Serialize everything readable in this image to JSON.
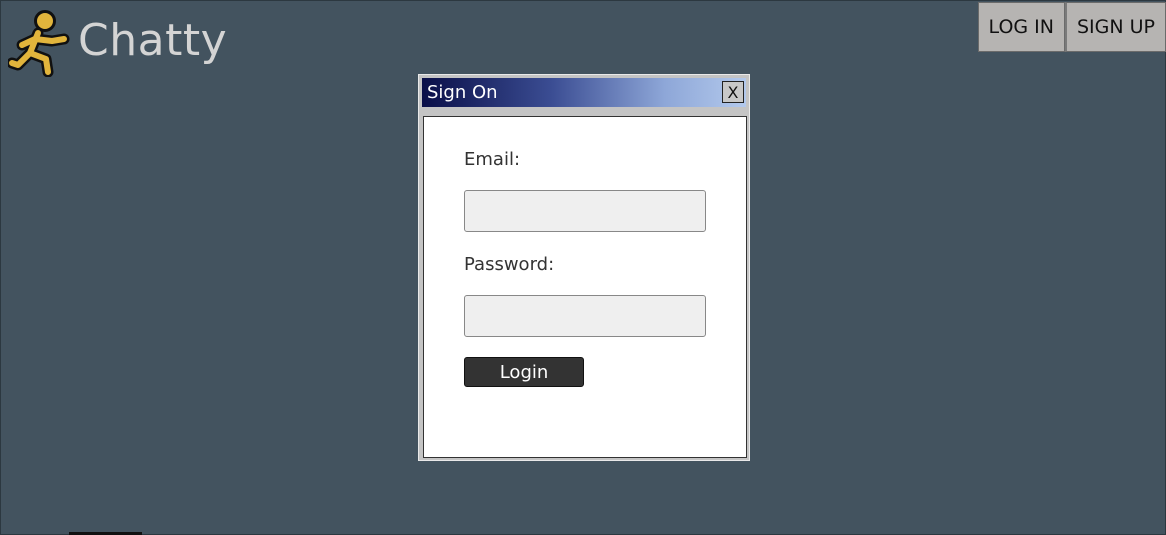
{
  "brand": {
    "name": "Chatty",
    "logo_icon": "running-man-icon",
    "logo_color": "#e2b53c"
  },
  "nav": {
    "login_label": "LOG IN",
    "signup_label": "SIGN UP"
  },
  "dialog": {
    "title": "Sign On",
    "close_label": "X",
    "email_label": "Email:",
    "email_value": "",
    "password_label": "Password:",
    "password_value": "",
    "submit_label": "Login"
  },
  "colors": {
    "background": "#43535f",
    "titlebar_start": "#0a0f48",
    "titlebar_end": "#b3c9ec",
    "button_dark": "#333333"
  }
}
